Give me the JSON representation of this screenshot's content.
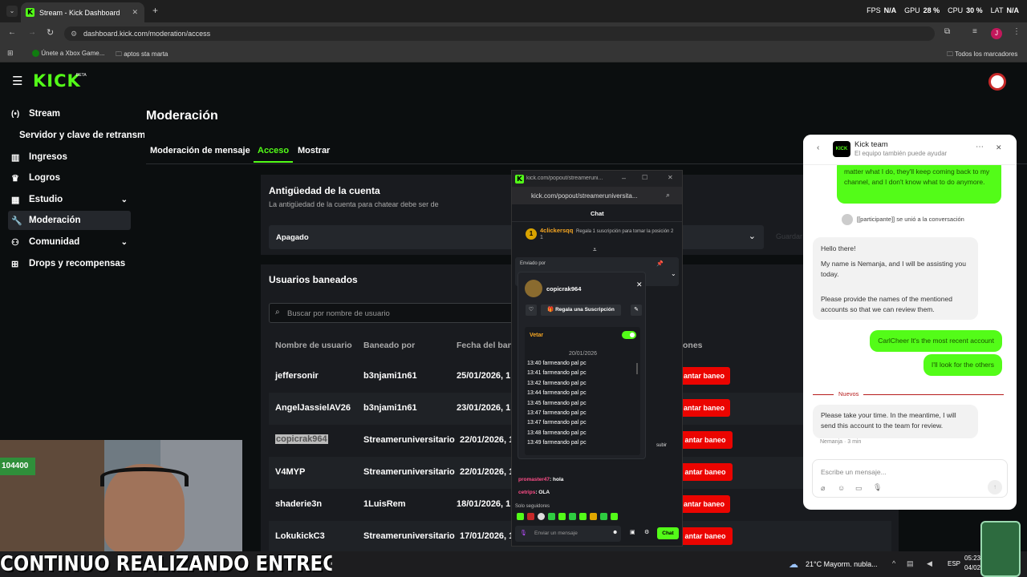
{
  "browser": {
    "tab_title": "Stream - Kick Dashboard",
    "url": "dashboard.kick.com/moderation/access",
    "bookmarks": [
      "Únete a Xbox Game...",
      "aptos sta marta"
    ],
    "all_bookmarks": "Todos los marcadores",
    "perf": {
      "fps_label": "FPS",
      "fps": "N/A",
      "gpu_label": "GPU",
      "gpu": "28 %",
      "cpu_label": "CPU",
      "cpu": "30 %",
      "lat_label": "LAT",
      "lat": "N/A"
    },
    "profile_initial": "J"
  },
  "logo": "KICK",
  "logo_badge": "BETA",
  "sidebar": {
    "items": [
      {
        "label": "Stream",
        "icon": "broadcast-icon"
      },
      {
        "label": "Servidor y clave de retransm",
        "icon": ""
      },
      {
        "label": "Ingresos",
        "icon": "chart-icon"
      },
      {
        "label": "Logros",
        "icon": "trophy-icon"
      },
      {
        "label": "Estudio",
        "icon": "studio-icon"
      },
      {
        "label": "Moderación",
        "icon": "wrench-icon"
      },
      {
        "label": "Comunidad",
        "icon": "people-icon"
      },
      {
        "label": "Drops y recompensas",
        "icon": "gift-icon"
      }
    ]
  },
  "main": {
    "title": "Moderación",
    "tabs": [
      "Moderación de mensaje",
      "Acceso",
      "Mostrar"
    ],
    "age_card": {
      "title": "Antigüedad de la cuenta",
      "description": "La antigüedad de la cuenta para chatear debe ser de",
      "select_value": "Apagado",
      "ghost_button": "Guardar"
    },
    "banned": {
      "title": "Usuarios baneados",
      "search_placeholder": "Buscar por nombre de usuario",
      "columns": [
        "Nombre de usuario",
        "Baneado por",
        "Fecha del ban",
        "ones"
      ],
      "rows": [
        {
          "user": "jeffersonir",
          "by": "b3njami1n61",
          "date": "25/01/2026, 1",
          "action": "antar baneo"
        },
        {
          "user": "AngelJassielAV26",
          "by": "b3njami1n61",
          "date": "23/01/2026, 1",
          "action": "antar baneo"
        },
        {
          "user": "copicrak964",
          "by": "Streameruniversitario",
          "date": "22/01/2026, 1",
          "action": "antar baneo"
        },
        {
          "user": "V4MYP",
          "by": "Streameruniversitario",
          "date": "22/01/2026, 1",
          "action": "antar baneo"
        },
        {
          "user": "shaderie3n",
          "by": "1LuisRem",
          "date": "18/01/2026, 1",
          "action": "antar baneo"
        },
        {
          "user": "LokukickC3",
          "by": "Streameruniversitario",
          "date": "17/01/2026, 1",
          "action": "antar baneo"
        }
      ]
    }
  },
  "popout": {
    "window_title": "kick.com/popout/streameruni...",
    "url": "kick.com/popout/streameruniversita...",
    "chat_title": "Chat",
    "gift_user": "4clickersqq",
    "gift_count": "1",
    "gift_text": "Regala 1 suscripción para tomar la posición 2",
    "sent_by": "Enviado por",
    "card_user": "copicrak964",
    "gift_sub_button": "Regala una Suscripción",
    "veto_label": "Vetar",
    "date": "20/01/2026",
    "messages": [
      {
        "time": "13:40",
        "text": "farmeando pal pc"
      },
      {
        "time": "13:41",
        "text": "farmeando pal pc"
      },
      {
        "time": "13:42",
        "text": "farmeando pal pc"
      },
      {
        "time": "13:44",
        "text": "farmeando pal pc"
      },
      {
        "time": "13:45",
        "text": "farmeando pal pc"
      },
      {
        "time": "13:47",
        "text": "farmeando pal pc"
      },
      {
        "time": "13:47",
        "text": "farmeando pal pc"
      },
      {
        "time": "13:48",
        "text": "farmeando pal pc"
      },
      {
        "time": "13:49",
        "text": "farmeando pal pc"
      }
    ],
    "chat_lines": [
      {
        "user": "promaster47",
        "text": ": hola"
      },
      {
        "user": "cetrips",
        "text": ": OLA"
      }
    ],
    "followers_only": "Solo seguidores",
    "input_placeholder": "Enviar un mensaje",
    "send_button": "Chat",
    "side_hint": "subir"
  },
  "support": {
    "title": "Kick team",
    "subtitle": "El equipo también puede ayudar",
    "msg_top": "matter what I do, they'll keep coming back to my channel, and I don't know what to do anymore.",
    "joined": "[[participante]] se unió a la conversación",
    "agent_greeting": "Hello there!",
    "agent_intro": "My name is Nemanja, and I will be assisting you today.",
    "agent_request": "Please provide the names of the mentioned accounts so that we can review them.",
    "user_reply1": "CarlCheer It's the most recent account",
    "user_reply2": "I'll look for the others",
    "new_label": "Nuevos",
    "agent_last": "Please take your time. In the meantime, I will send this account to the team for review.",
    "agent_meta": "Nemanja · 3 min",
    "input_placeholder": "Escribe un mensaje..."
  },
  "overlay": {
    "caption": "CONTINUO REALIZANDO ENTREGAS",
    "cam_counter": "104400"
  },
  "taskbar": {
    "weather": "21°C  Mayorm. nubla...",
    "lang": "ESP",
    "time": "05:23",
    "date": "04/02/"
  },
  "colors": {
    "kick_green": "#53fc18",
    "danger_red": "#eb0400",
    "surface": "#191b1f"
  }
}
